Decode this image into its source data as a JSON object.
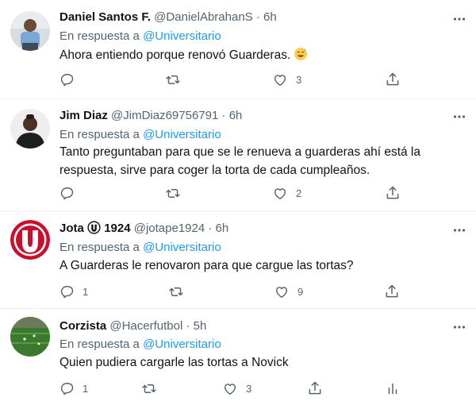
{
  "tweets": [
    {
      "name": "Daniel Santos F.",
      "handle": "@DanielAbrahanS",
      "sep": "·",
      "time": "6h",
      "reply_prefix": "En respuesta a",
      "reply_mention": "@Universitario",
      "text": "Ahora entiendo porque renovó Guarderas.",
      "emoji": "sweat-smile-emoji",
      "actions": {
        "reply": "",
        "retweet": "",
        "like": "3",
        "share": ""
      }
    },
    {
      "name": "Jim Diaz",
      "handle": "@JimDiaz69756791",
      "sep": "·",
      "time": "6h",
      "reply_prefix": "En respuesta a",
      "reply_mention": "@Universitario",
      "text_line1": "Tanto preguntaban para que se le renueva a guarderas ahí está la",
      "text_line2": "respuesta, sirve para coger la torta de cada cumpleaños.",
      "actions": {
        "reply": "",
        "retweet": "",
        "like": "2",
        "share": ""
      }
    },
    {
      "name": "Jota",
      "name_icon": "universitario-badge-icon",
      "name_suffix": "1924",
      "handle": "@jotape1924",
      "sep": "·",
      "time": "6h",
      "reply_prefix": "En respuesta a",
      "reply_mention": "@Universitario",
      "text": "A Guarderas le renovaron para que cargue las tortas?",
      "actions": {
        "reply": "1",
        "retweet": "",
        "like": "9",
        "share": ""
      }
    },
    {
      "name": "Corzista",
      "handle": "@Hacerfutbol",
      "sep": "·",
      "time": "5h",
      "reply_prefix": "En respuesta a",
      "reply_mention": "@Universitario",
      "text": "Quien pudiera cargarle las tortas a Novick",
      "actions": {
        "reply": "1",
        "retweet": "",
        "like": "3",
        "share": "",
        "analytics": ""
      }
    }
  ],
  "colors": {
    "text": "#0f1419",
    "secondary": "#536471",
    "mention": "#1d9bf0",
    "divider": "#eff3f4",
    "universitario_red": "#c8102e"
  },
  "icons": [
    "more-icon",
    "reply-icon",
    "retweet-icon",
    "like-icon",
    "share-icon",
    "analytics-icon"
  ]
}
